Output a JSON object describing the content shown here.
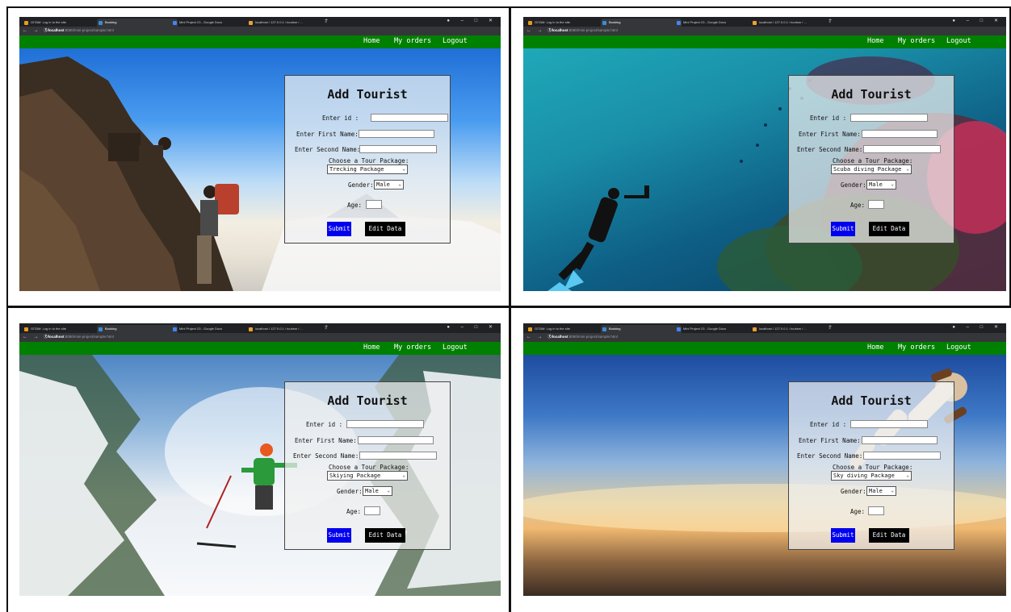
{
  "browser": {
    "tabs": [
      "GITAM: Log in to the site",
      "Booking",
      "Mini Project 23 - Google Docs",
      "localhost / 127.0.0.1 / tourism / ..."
    ],
    "url_host": "localhost",
    "url_rest": ":8080/mini-project/sample.html"
  },
  "nav": {
    "home": "Home",
    "orders": "My orders",
    "logout": "Logout"
  },
  "form": {
    "title": "Add Tourist",
    "id_label": "Enter id :",
    "first_label": "Enter First Name:",
    "second_label": "Enter Second Name:",
    "package_label": "Choose a Tour Package:",
    "gender_label": "Gender:",
    "gender_value": "Male",
    "age_label": "Age:",
    "submit": "Submit",
    "edit": "Edit Data"
  },
  "panels": [
    {
      "scene": "mountain climbing",
      "package": "Trecking Package"
    },
    {
      "scene": "scuba diving",
      "package": "Scuba diving Package"
    },
    {
      "scene": "skiing",
      "package": "Skiying Package"
    },
    {
      "scene": "sky diving",
      "package": "Sky diving Package"
    }
  ],
  "colors": {
    "navbar": "#008000",
    "submit": "#0000ee",
    "edit": "#000000"
  }
}
